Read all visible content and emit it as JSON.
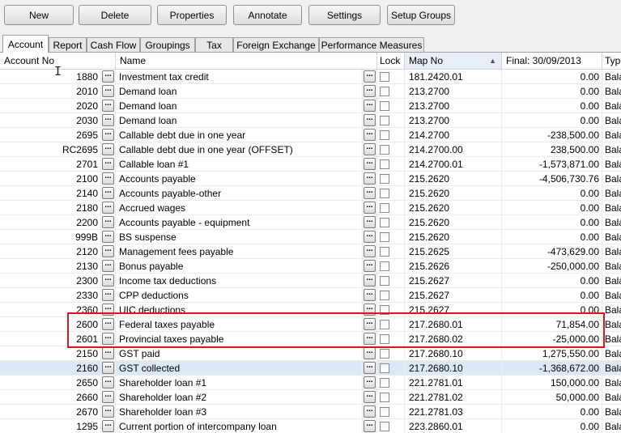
{
  "toolbar": {
    "buttons": [
      "New",
      "Delete",
      "Properties",
      "Annotate",
      "Settings",
      "Setup Groups"
    ]
  },
  "tabs": [
    "Account",
    "Report",
    "Cash Flow",
    "Groupings",
    "Tax",
    "Foreign Exchange",
    "Performance Measures"
  ],
  "active_tab": "Account",
  "columns": {
    "acct": "Account No",
    "name": "Name",
    "lock": "Lock",
    "map": "Map No",
    "final": "Final: 30/09/2013",
    "type": "Typ"
  },
  "button_text": "...",
  "rows": [
    {
      "acct": "1880",
      "name": "Investment tax credit",
      "map": "181.2420.01",
      "final": "0.00",
      "type": "Bala"
    },
    {
      "acct": "2010",
      "name": "Demand loan",
      "map": "213.2700",
      "final": "0.00",
      "type": "Bala"
    },
    {
      "acct": "2020",
      "name": "Demand loan",
      "map": "213.2700",
      "final": "0.00",
      "type": "Bala"
    },
    {
      "acct": "2030",
      "name": "Demand loan",
      "map": "213.2700",
      "final": "0.00",
      "type": "Bala"
    },
    {
      "acct": "2695",
      "name": "Callable debt due in one year",
      "map": "214.2700",
      "final": "-238,500.00",
      "type": "Bala"
    },
    {
      "acct": "RC2695",
      "name": "Callable debt due in one year (OFFSET)",
      "map": "214.2700.00",
      "final": "238,500.00",
      "type": "Bala"
    },
    {
      "acct": "2701",
      "name": "Callable loan #1",
      "map": "214.2700.01",
      "final": "-1,573,871.00",
      "type": "Bala"
    },
    {
      "acct": "2100",
      "name": "Accounts payable",
      "map": "215.2620",
      "final": "-4,506,730.76",
      "type": "Bala"
    },
    {
      "acct": "2140",
      "name": "Accounts payable-other",
      "map": "215.2620",
      "final": "0.00",
      "type": "Bala"
    },
    {
      "acct": "2180",
      "name": "Accrued wages",
      "map": "215.2620",
      "final": "0.00",
      "type": "Bala"
    },
    {
      "acct": "2200",
      "name": "Accounts payable - equipment",
      "map": "215.2620",
      "final": "0.00",
      "type": "Bala"
    },
    {
      "acct": "999B",
      "name": "BS suspense",
      "map": "215.2620",
      "final": "0.00",
      "type": "Bala"
    },
    {
      "acct": "2120",
      "name": "Management fees payable",
      "map": "215.2625",
      "final": "-473,629.00",
      "type": "Bala"
    },
    {
      "acct": "2130",
      "name": "Bonus payable",
      "map": "215.2626",
      "final": "-250,000.00",
      "type": "Bala"
    },
    {
      "acct": "2300",
      "name": "Income tax deductions",
      "map": "215.2627",
      "final": "0.00",
      "type": "Bala"
    },
    {
      "acct": "2330",
      "name": "CPP deductions",
      "map": "215.2627",
      "final": "0.00",
      "type": "Bala"
    },
    {
      "acct": "2360",
      "name": "UIC deductions",
      "map": "215.2627",
      "final": "0.00",
      "type": "Bala"
    },
    {
      "acct": "2600",
      "name": "Federal taxes payable",
      "map": "217.2680.01",
      "final": "71,854.00",
      "type": "Bala"
    },
    {
      "acct": "2601",
      "name": "Provincial taxes payable",
      "map": "217.2680.02",
      "final": "-25,000.00",
      "type": "Bala"
    },
    {
      "acct": "2150",
      "name": "GST paid",
      "map": "217.2680.10",
      "final": "1,275,550.00",
      "type": "Bala"
    },
    {
      "acct": "2160",
      "name": "GST collected",
      "map": "217.2680.10",
      "final": "-1,368,672.00",
      "type": "Bala"
    },
    {
      "acct": "2650",
      "name": "Shareholder loan #1",
      "map": "221.2781.01",
      "final": "150,000.00",
      "type": "Bala"
    },
    {
      "acct": "2660",
      "name": "Shareholder loan #2",
      "map": "221.2781.02",
      "final": "50,000.00",
      "type": "Bala"
    },
    {
      "acct": "2670",
      "name": "Shareholder loan #3",
      "map": "221.2781.03",
      "final": "0.00",
      "type": "Bala"
    },
    {
      "acct": "1295",
      "name": "Current portion of intercompany loan",
      "map": "223.2860.01",
      "final": "0.00",
      "type": "Bala"
    }
  ],
  "highlighted_row_index": 20,
  "accent": {
    "highlight_box": "#e0141c",
    "selected_row": "#dde8f7"
  }
}
